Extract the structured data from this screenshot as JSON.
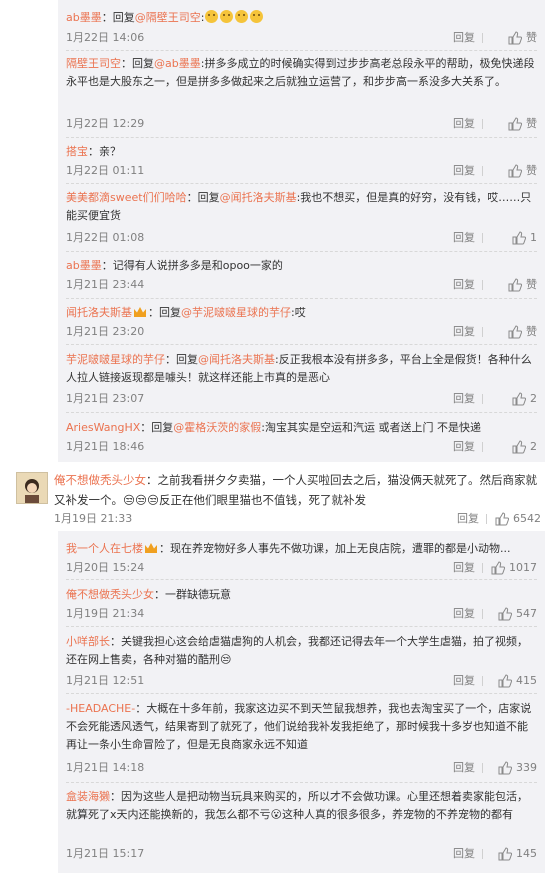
{
  "ui": {
    "reply_label": "回复"
  },
  "thread1": [
    {
      "author": "ab墨墨",
      "body": [
        {
          "t": "：回复"
        },
        {
          "t": "@隔壁王司空",
          "m": true
        },
        {
          "t": ":"
        }
      ],
      "emoji_count": 4,
      "date": "1月22日 14:06",
      "like": "赞"
    },
    {
      "author": "隔壁王司空",
      "body": [
        {
          "t": "：回复"
        },
        {
          "t": "@ab墨墨",
          "m": true
        },
        {
          "t": ":拼多多成立的时候确实得到过步步高老总段永平的帮助，极免快递段永平也是大股东之一，但是拼多多做起来之后就独立运营了，和步步高一系没多大关系了。"
        }
      ],
      "date": "1月22日 12:29",
      "like": "赞"
    },
    {
      "author": "搭宝",
      "body": [
        {
          "t": "：亲？"
        }
      ],
      "date": "1月22日 01:11",
      "like": "赞"
    },
    {
      "author": "美美都滴sweet们们哈哈",
      "body": [
        {
          "t": "：回复"
        },
        {
          "t": "@闻托洛夫斯基",
          "m": true
        },
        {
          "t": ":我也不想买，但是真的好穷，没有钱，哎……只能买便宜货"
        }
      ],
      "date": "1月22日 01:08",
      "like": "1"
    },
    {
      "author": "ab墨墨",
      "body": [
        {
          "t": "：记得有人说拼多多是和opoo一家的"
        }
      ],
      "date": "1月21日 23:44",
      "like": "赞"
    },
    {
      "author": "闻托洛夫斯基",
      "crown": true,
      "body": [
        {
          "t": "：回复"
        },
        {
          "t": "@芋泥啵啵星球的芋仔",
          "m": true
        },
        {
          "t": ":哎"
        }
      ],
      "date": "1月21日 23:20",
      "like": "赞"
    },
    {
      "author": "芋泥啵啵星球的芋仔",
      "body": [
        {
          "t": "：回复"
        },
        {
          "t": "@闻托洛夫斯基",
          "m": true
        },
        {
          "t": ":反正我根本没有拼多多，平台上全是假货！各种什么人拉人链接返现都是噱头！就这样还能上市真的是恶心"
        }
      ],
      "date": "1月21日 23:07",
      "like": "2"
    },
    {
      "author": "AriesWangHX",
      "body": [
        {
          "t": "：回复"
        },
        {
          "t": "@霍格沃茨的家假",
          "m": true
        },
        {
          "t": ":淘宝其实是空运和汽运 或者送上门 不是快递"
        }
      ],
      "date": "1月21日 18:46",
      "like": "2"
    }
  ],
  "main": {
    "author": "俺不想做秃头少女",
    "body": "：之前我看拼夕夕卖猫，一个人买啦回去之后，猫没俩天就死了。然后商家就又补发一个。😒😒😒反正在他们眼里猫也不值钱，死了就补发",
    "date": "1月19日 21:33",
    "like": "6542"
  },
  "thread2": [
    {
      "author": "我一个人在七楼",
      "crown": true,
      "body": [
        {
          "t": "：现在养宠物好多人事先不做功课，加上无良店院，遭罪的都是小动物..."
        }
      ],
      "date": "1月20日 15:24",
      "like": "1017"
    },
    {
      "author": "俺不想做秃头少女",
      "body": [
        {
          "t": "：一群缺德玩意"
        }
      ],
      "date": "1月19日 21:34",
      "like": "547"
    },
    {
      "author": "小咩部长",
      "body": [
        {
          "t": "：关键我担心这会给虐猫虐狗的人机会，我都还记得去年一个大学生虐猫，拍了视频，还在网上售卖，各种对猫的酷刑😒"
        }
      ],
      "date": "1月21日 12:51",
      "like": "415"
    },
    {
      "author": "-HEADACHE-",
      "body": [
        {
          "t": "：大概在十多年前，我家这边买不到天竺鼠我想养，我也去淘宝买了一个，店家说不会死能透风透气，结果寄到了就死了，他们说给我补发我拒绝了，那时候我十多岁也知道不能再让一条小生命冒险了，但是无良商家永远不知道"
        }
      ],
      "date": "1月21日 14:18",
      "like": "339"
    },
    {
      "author": "盒装海獭",
      "body": [
        {
          "t": "：因为这些人是把动物当玩具来购买的，所以才不会做功课。心里还想着卖家能包活，就算死了x天内还能换新的，我怎么都不亏😮这种人真的很多很多，养宠物的不养宠物的都有"
        }
      ],
      "date": "1月21日 15:17",
      "like": "145"
    }
  ]
}
